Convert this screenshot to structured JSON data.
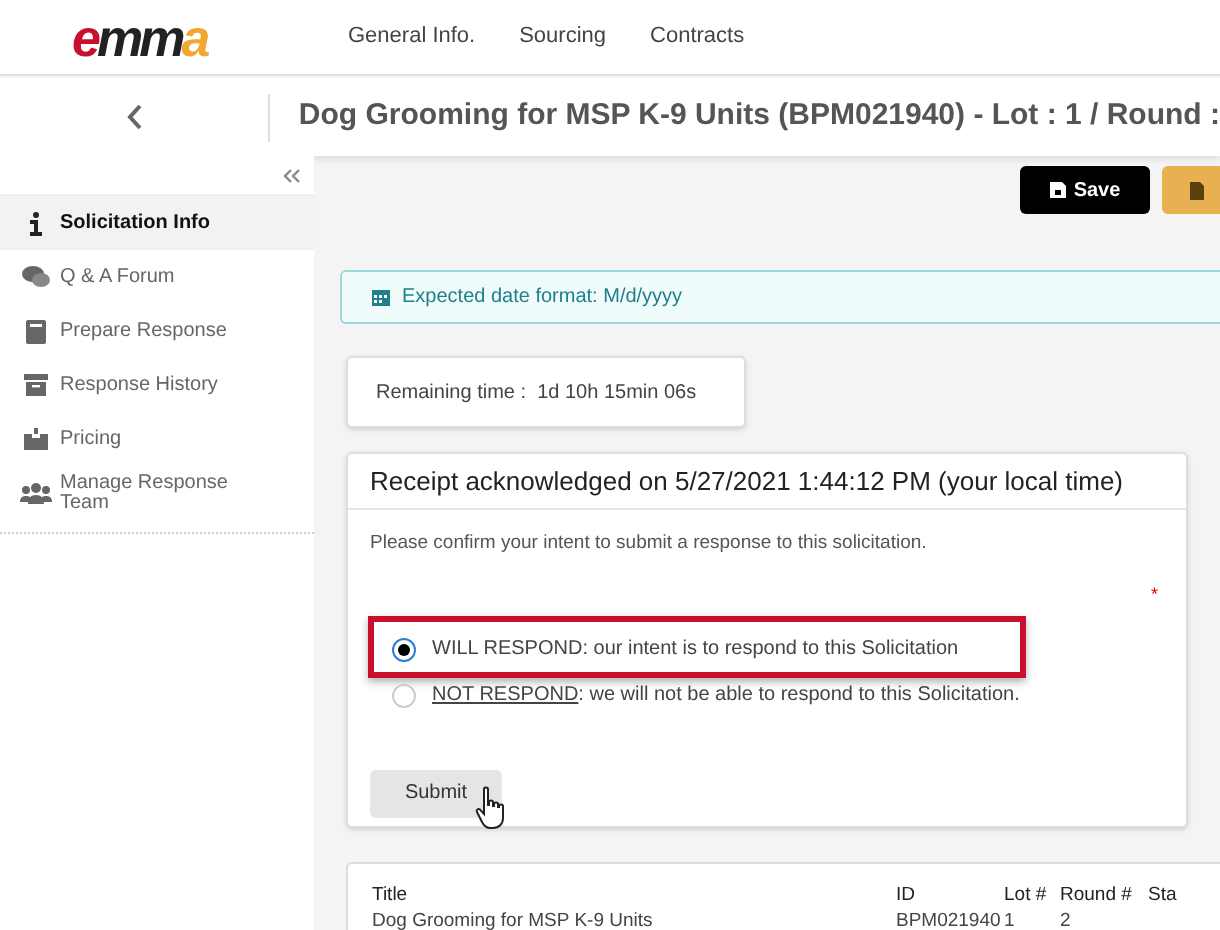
{
  "logo": {
    "text": "emma"
  },
  "nav": [
    {
      "label": "General Info."
    },
    {
      "label": "Sourcing"
    },
    {
      "label": "Contracts"
    }
  ],
  "header": {
    "title": "Dog Grooming for MSP K-9 Units (BPM021940) - Lot : 1 / Round :"
  },
  "sidebar": {
    "items": [
      {
        "label": "Solicitation Info",
        "selected": true
      },
      {
        "label": "Q & A Forum",
        "selected": false
      },
      {
        "label": "Prepare Response",
        "selected": false
      },
      {
        "label": "Response History",
        "selected": false
      },
      {
        "label": "Pricing",
        "selected": false
      },
      {
        "label": "Manage Response Team",
        "selected": false
      }
    ]
  },
  "toolbar": {
    "buttons": [
      {
        "label": "Save",
        "kind": "save"
      },
      {
        "kind": "document"
      }
    ]
  },
  "alert": {
    "text": "Expected date format: M/d/yyyy"
  },
  "remaining": {
    "text": "Remaining time :  1d 10h 15min 06s"
  },
  "intent": {
    "title": "Receipt acknowledged on 5/27/2021 1:44:12 PM (your local time)",
    "prompt": "Please confirm your intent to submit a response to this solicitation.",
    "required_mark": "*",
    "options": [
      {
        "label": "WILL RESPOND",
        "rest": ": our intent is to respond to this Solicitation",
        "selected": true,
        "highlighted": true,
        "underlined": false
      },
      {
        "label": "NOT RESPOND",
        "rest": ": we will not be able to respond to this Solicitation.",
        "selected": false,
        "highlighted": false,
        "underlined": true
      }
    ],
    "submit": "Submit"
  },
  "table": {
    "columns": [
      "Title",
      "ID",
      "Lot #",
      "Round #",
      "Sta"
    ],
    "rows": [
      [
        "Dog Grooming for MSP K-9 Units",
        "BPM021940",
        "1",
        "2"
      ]
    ]
  }
}
